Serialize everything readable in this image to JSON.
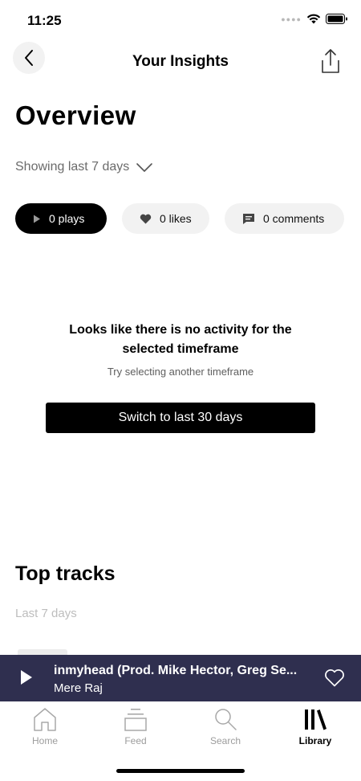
{
  "status_bar": {
    "time": "11:25"
  },
  "nav": {
    "title": "Your Insights"
  },
  "overview": {
    "heading": "Overview",
    "timeframe_label": "Showing last 7 days"
  },
  "chips": {
    "plays": "0 plays",
    "likes": "0 likes",
    "comments": "0 comments"
  },
  "empty_state": {
    "title": "Looks like there is no activity for the selected timeframe",
    "subtitle": "Try selecting another timeframe",
    "button_label": "Switch to last 30 days"
  },
  "top_tracks": {
    "heading": "Top tracks",
    "period": "Last 7 days"
  },
  "mini_player": {
    "track_title": "inmyhead (Prod. Mike Hector, Greg Se...",
    "artist": "Mere Raj",
    "progress_color": "#ff5500",
    "background_color": "#2f2f4f"
  },
  "tab_bar": {
    "home": "Home",
    "feed": "Feed",
    "search": "Search",
    "library": "Library"
  }
}
